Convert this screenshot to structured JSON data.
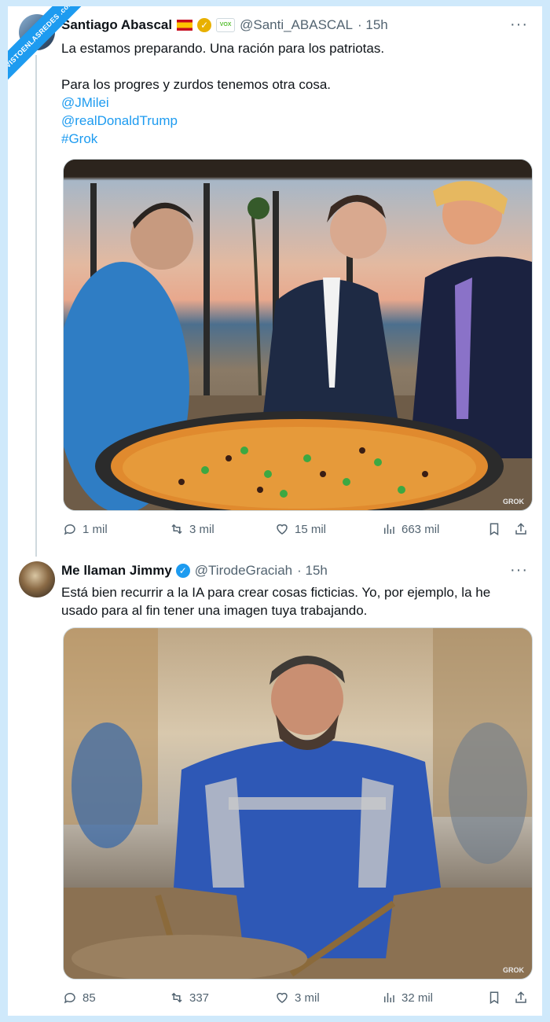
{
  "watermark_corner": "VISTOENLASREDES .com",
  "tweets": [
    {
      "name": "Santiago Abascal",
      "handle": "@Santi_ABASCAL",
      "time": "· 15h",
      "text_lines": [
        "La estamos preparando. Una ración para los patriotas.",
        "",
        "Para los progres y zurdos tenemos otra cosa."
      ],
      "links": [
        "@JMilei",
        "@realDonaldTrump",
        "#Grok"
      ],
      "image_label": "GROK",
      "stats": {
        "replies": "1 mil",
        "retweets": "3 mil",
        "likes": "15 mil",
        "views": "663 mil"
      }
    },
    {
      "name": "Me llaman Jimmy",
      "handle": "@TirodeGraciah",
      "time": "· 15h",
      "text_lines": [
        "Está bien recurrir a la IA para crear cosas ficticias. Yo, por ejemplo, la he",
        "usado para al fin tener una imagen tuya trabajando."
      ],
      "image_label": "GROK",
      "stats": {
        "replies": "85",
        "retweets": "337",
        "likes": "3 mil",
        "views": "32 mil"
      }
    }
  ],
  "colors": {
    "accent": "#1d9bf0",
    "text": "#0f1419",
    "muted": "#536471",
    "border": "#cfd9de"
  }
}
